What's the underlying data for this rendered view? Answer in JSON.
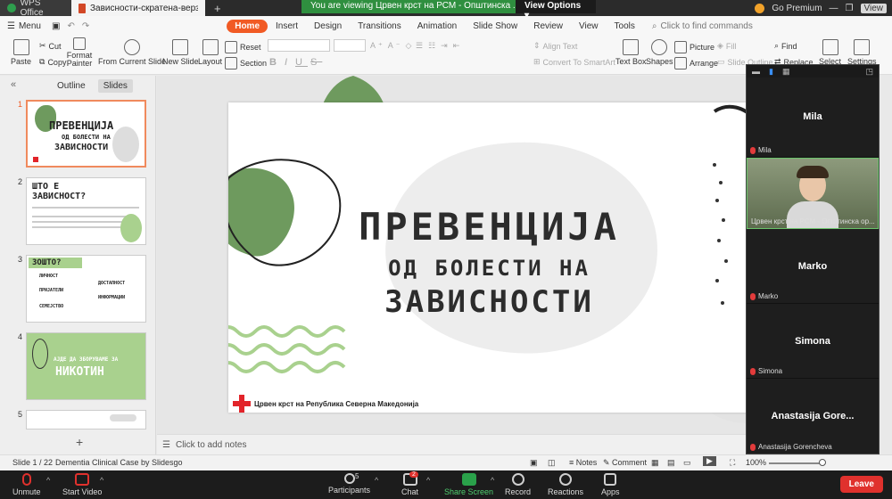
{
  "titlebar": {
    "app_tab": "WPS Office",
    "doc_tab": "Зависности-скратена-верзија",
    "add_tab": "+",
    "banner_message": "You are viewing Црвен крст на РСМ - Општинска ...'s screen",
    "view_options": "View Options ▾",
    "go_premium": "Go Premium",
    "view_label": "View"
  },
  "ribbon": {
    "menu_label": "Menu",
    "tabs": [
      "Home",
      "Insert",
      "Design",
      "Transitions",
      "Animation",
      "Slide Show",
      "Review",
      "View",
      "Tools"
    ],
    "active_tab": "Home",
    "find_commands": "Click to find commands",
    "tools": {
      "paste": "Paste",
      "cut": "Cut",
      "copy": "Copy",
      "format_painter": "Format Painter",
      "from_current_slide": "From Current Slide",
      "new_slide": "New Slide",
      "layout": "Layout",
      "reset": "Reset",
      "section": "Section",
      "align_text": "Align Text",
      "convert_smartart": "Convert To SmartArt",
      "text_box": "Text Box",
      "shapes": "Shapes",
      "picture": "Picture",
      "arrange": "Arrange",
      "fill": "Fill",
      "slide_outline": "Slide Outline",
      "find": "Find",
      "replace": "Replace",
      "select": "Select",
      "settings": "Settings"
    }
  },
  "left_panel": {
    "tabs": [
      "Outline",
      "Slides"
    ],
    "active_tab": "Slides",
    "collapse_icon": "«",
    "add_slide": "+",
    "slides": [
      {
        "num": "1",
        "title": "ПРЕВЕНЦИЈА",
        "subtitle": "ОД БОЛЕСТИ НА",
        "title2": "ЗАВИСНОСТИ"
      },
      {
        "num": "2",
        "title": "ШТО Е",
        "title2": "ЗАВИСНОСТ?"
      },
      {
        "num": "3",
        "title": "ЗОШТО?",
        "items": [
          "ЛИЧНОСТ",
          "ПРИЈАТЕЛИ",
          "СЕМЕЈСТВО",
          "ДОСТАПНОСТ",
          "ИНФОРМАЦИИ"
        ]
      },
      {
        "num": "4",
        "title": "АЈДЕ ДА ЗБОРУВАМЕ ЗА",
        "title2": "НИКОТИН"
      },
      {
        "num": "5"
      }
    ]
  },
  "slide": {
    "title": "ПРЕВЕНЦИЈА",
    "subtitle": "ОД БОЛЕСТИ НА",
    "title2": "ЗАВИСНОСТИ",
    "org": "Црвен крст на Република Северна Македонија",
    "accent_green": "#6e9a5e",
    "light_green": "#a9d18e",
    "red_cross": "#e2242a"
  },
  "notes_placeholder": "Click to add notes",
  "statusbar": {
    "slide_count": "Slide 1 / 22",
    "theme": "Dementia Clinical Case by Slidesgo",
    "notes": "Notes",
    "comment": "Comment",
    "zoom": "100%"
  },
  "participants": [
    {
      "name": "Mila",
      "label": "Mila",
      "video": false
    },
    {
      "name": "",
      "label": "Црвен крст на РСМ - Општинска ор...",
      "video": true
    },
    {
      "name": "Marko",
      "label": "Marko",
      "video": false
    },
    {
      "name": "Simona",
      "label": "Simona",
      "video": false
    },
    {
      "name": "Anastasija Gore...",
      "label": "Anastasija Gorencheva",
      "video": false
    }
  ],
  "zoom_bar": {
    "unmute": "Unmute",
    "start_video": "Start Video",
    "participants": "Participants",
    "participants_count": "5",
    "chat": "Chat",
    "chat_badge": "2",
    "share_screen": "Share Screen",
    "record": "Record",
    "reactions": "Reactions",
    "apps": "Apps",
    "leave": "Leave"
  }
}
